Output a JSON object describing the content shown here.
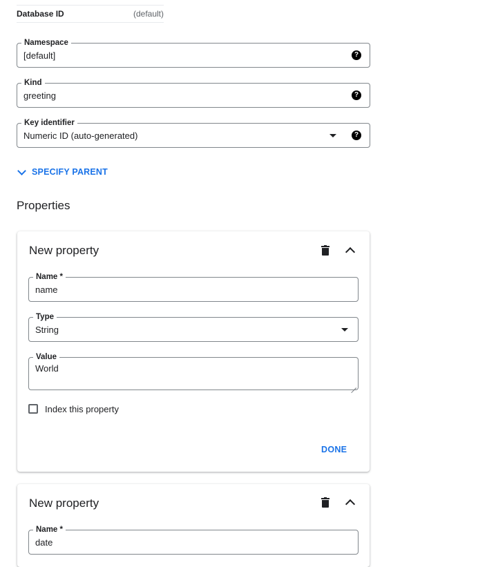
{
  "database": {
    "label": "Database ID",
    "value": "(default)"
  },
  "namespace": {
    "label": "Namespace",
    "value": "[default]",
    "help_icon": "help-icon"
  },
  "kind": {
    "label": "Kind",
    "value": "greeting",
    "help_icon": "help-icon"
  },
  "key_identifier": {
    "label": "Key identifier",
    "value": "Numeric ID (auto-generated)",
    "help_icon": "help-icon"
  },
  "specify_parent": {
    "label": "SPECIFY PARENT"
  },
  "properties_title": "Properties",
  "properties": [
    {
      "title": "New property",
      "name_label": "Name *",
      "name_value": "name",
      "type_label": "Type",
      "type_value": "String",
      "value_label": "Value",
      "value_value": "World",
      "index_label": "Index this property",
      "index_checked": false,
      "done_label": "DONE"
    },
    {
      "title": "New property",
      "name_label": "Name *",
      "name_value": "date"
    }
  ],
  "colors": {
    "accent": "#1a73e8",
    "border": "#80868b",
    "text": "#202124"
  }
}
